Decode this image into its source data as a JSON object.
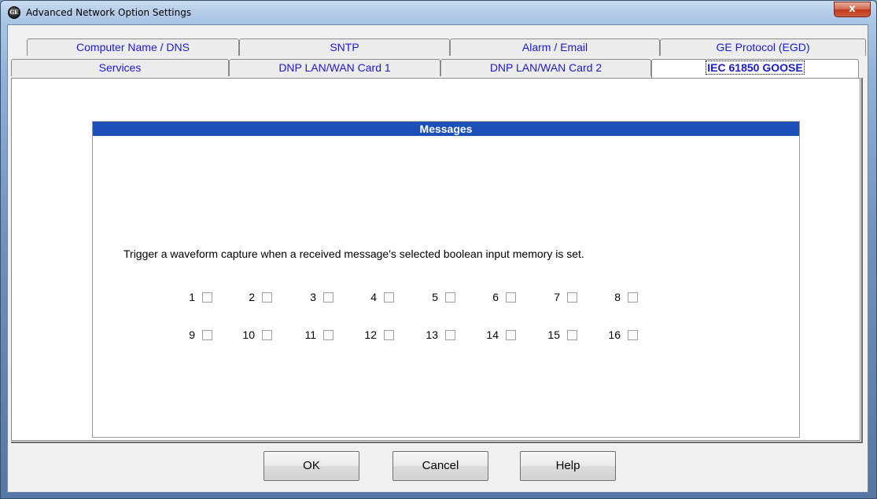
{
  "window": {
    "title": "Advanced Network Option Settings",
    "app_icon_text": "GE",
    "close_glyph": "x"
  },
  "tabs_row1": [
    "Computer Name / DNS",
    "SNTP",
    "Alarm / Email",
    "GE Protocol (EGD)"
  ],
  "tabs_row2": [
    "Services",
    "DNP LAN/WAN Card 1",
    "DNP LAN/WAN Card 2",
    "IEC 61850 GOOSE"
  ],
  "active_tab": "IEC 61850 GOOSE",
  "group": {
    "title": "Messages",
    "instruction": "Trigger a waveform capture when a received message's selected boolean input memory is set."
  },
  "checkboxes": {
    "row1": [
      "1",
      "2",
      "3",
      "4",
      "5",
      "6",
      "7",
      "8"
    ],
    "row2": [
      "9",
      "10",
      "11",
      "12",
      "13",
      "14",
      "15",
      "16"
    ],
    "checked": []
  },
  "buttons": {
    "ok": "OK",
    "cancel": "Cancel",
    "help": "Help"
  },
  "colors": {
    "tab_text": "#1a1ad0",
    "header_bg": "#1c50b8",
    "close_button": "#c0391b"
  }
}
